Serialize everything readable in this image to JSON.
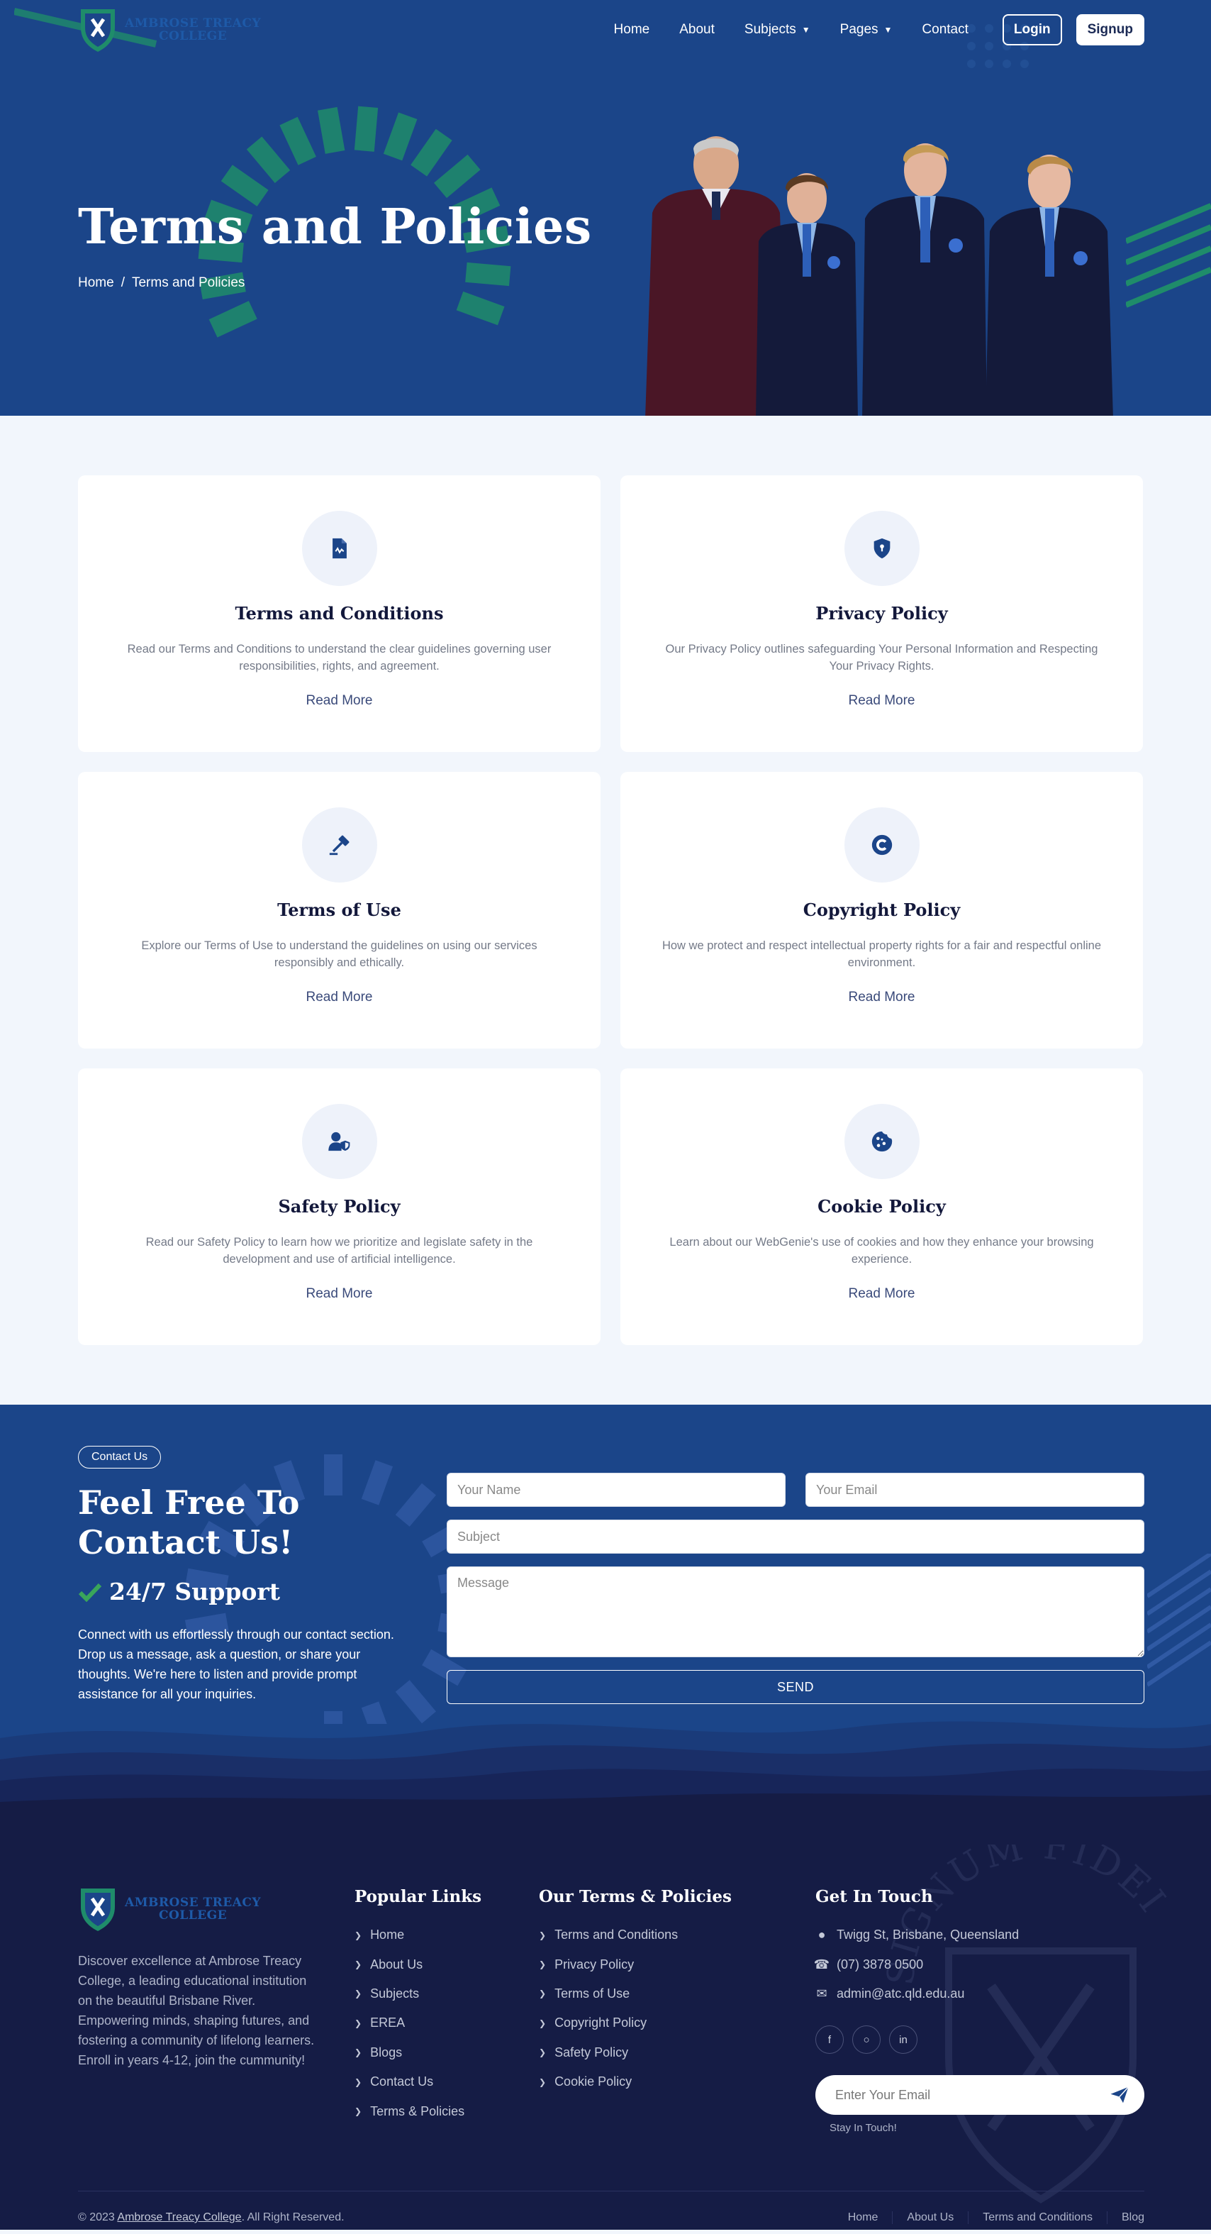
{
  "nav": {
    "logo_line1": "AMBROSE TREACY",
    "logo_line2": "COLLEGE",
    "links": [
      "Home",
      "About",
      "Subjects",
      "Pages",
      "Contact"
    ],
    "login": "Login",
    "signup": "Signup"
  },
  "hero": {
    "title": "Terms and Policies",
    "breadcrumb_home": "Home",
    "breadcrumb_sep": "/",
    "breadcrumb_current": "Terms and Policies"
  },
  "policies": [
    {
      "icon": "document-icon",
      "title": "Terms and Conditions",
      "desc": "Read our Terms and Conditions to understand the clear guidelines governing user responsibilities, rights, and agreement.",
      "link": "Read More"
    },
    {
      "icon": "shield-lock-icon",
      "title": "Privacy Policy",
      "desc": "Our Privacy Policy outlines safeguarding Your Personal Information and Respecting Your Privacy Rights.",
      "link": "Read More"
    },
    {
      "icon": "gavel-icon",
      "title": "Terms of Use",
      "desc": "Explore our Terms of Use to understand the guidelines on using our services responsibly and ethically.",
      "link": "Read More"
    },
    {
      "icon": "copyright-icon",
      "title": "Copyright Policy",
      "desc": "How we protect and respect intellectual property rights for a fair and respectful online environment.",
      "link": "Read More"
    },
    {
      "icon": "user-shield-icon",
      "title": "Safety Policy",
      "desc": "Read our Safety Policy to learn how we prioritize and legislate safety in the development and use of artificial intelligence.",
      "link": "Read More"
    },
    {
      "icon": "cookie-icon",
      "title": "Cookie Policy",
      "desc": "Learn about our WebGenie's use of cookies and how they enhance your browsing experience.",
      "link": "Read More"
    }
  ],
  "contact": {
    "pill": "Contact Us",
    "title": "Feel Free To Contact Us!",
    "support": "24/7 Support",
    "text": "Connect with us effortlessly through our contact section. Drop us a message, ask a question, or share your thoughts. We're here to listen and provide prompt assistance for all your inquiries.",
    "name_placeholder": "Your Name",
    "email_placeholder": "Your Email",
    "subject_placeholder": "Subject",
    "message_placeholder": "Message",
    "send": "SEND"
  },
  "footer": {
    "about": "Discover excellence at Ambrose Treacy College, a leading educational institution on the beautiful Brisbane River. Empowering minds, shaping futures, and fostering a community of lifelong learners. Enroll in years 4-12, join the cummunity!",
    "popular_heading": "Popular Links",
    "popular": [
      "Home",
      "About Us",
      "Subjects",
      "EREA",
      "Blogs",
      "Contact Us",
      "Terms & Policies"
    ],
    "terms_heading": "Our Terms & Policies",
    "terms": [
      "Terms and Conditions",
      "Privacy Policy",
      "Terms of Use",
      "Copyright Policy",
      "Safety Policy",
      "Cookie Policy"
    ],
    "touch_heading": "Get In Touch",
    "address": "Twigg St, Brisbane, Queensland",
    "phone": "(07) 3878 0500",
    "email": "admin@atc.qld.edu.au",
    "socials": [
      "facebook-icon",
      "instagram-icon",
      "linkedin-icon"
    ],
    "subscribe_placeholder": "Enter Your Email",
    "subscribe_note": "Stay In Touch!",
    "crest_text": "SIGNUM FIDEI",
    "copyright_prefix": "© 2023",
    "copyright_name": "Ambrose Treacy College",
    "copyright_suffix": ". All Right Reserved.",
    "bottom_links": [
      "Home",
      "About Us",
      "Terms and Conditions",
      "Blog"
    ]
  },
  "colors": {
    "primary": "#1b4589",
    "dark": "#151c45",
    "accent_green": "#1f8c6a",
    "check_green": "#3aa55a"
  }
}
